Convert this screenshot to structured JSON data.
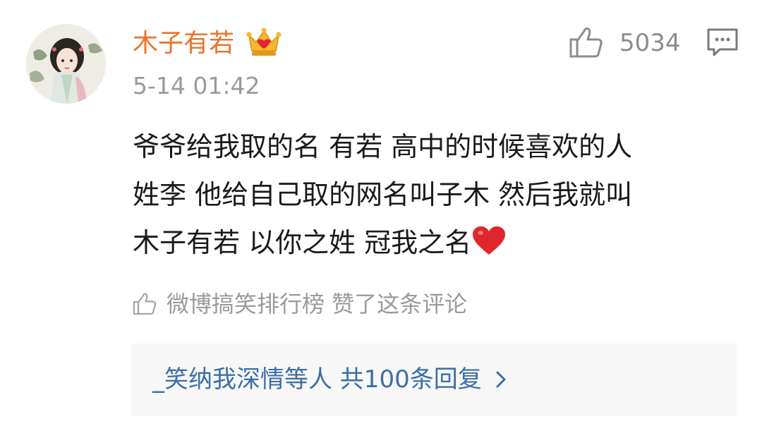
{
  "comment": {
    "username": "木子有若",
    "timestamp": "5-14 01:42",
    "like_count": "5034",
    "body_lines": [
      "爷爷给我取的名 有若 高中的时候喜欢的人",
      "姓李 他给自己取的网名叫子木 然后我就叫",
      "木子有若 以你之姓 冠我之名"
    ],
    "liked_by_text": "微博搞笑排行榜 赞了这条评论",
    "reply_summary": "_笑纳我深情等人  共100条回复"
  },
  "icons": {
    "crown": "crown-icon",
    "like": "thumbs-up-icon",
    "comment": "comment-icon",
    "heart": "heart-icon",
    "chevron": "chevron-right-icon"
  },
  "colors": {
    "username": "#e8742a",
    "reply_link": "#3b6ea8",
    "muted": "#9a9a9a",
    "heart": "#e0262c"
  }
}
